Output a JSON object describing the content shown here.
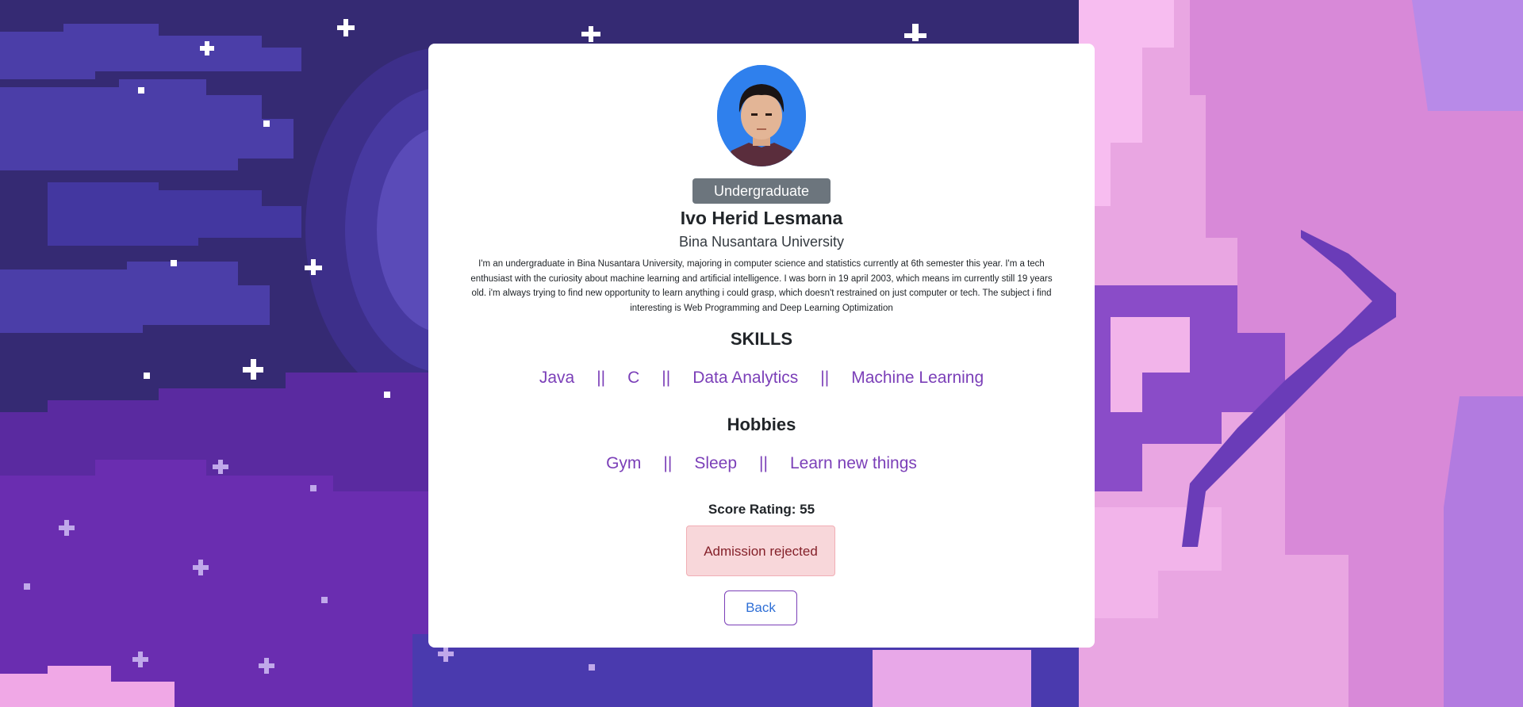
{
  "profile": {
    "status_badge": "Undergraduate",
    "name": "Ivo Herid Lesmana",
    "university": "Bina Nusantara University",
    "description": "I'm an undergraduate in Bina Nusantara University, majoring in computer science and statistics currently at 6th semester this year. I'm a tech enthusiast with the curiosity about machine learning and artificial intelligence. I was born in 19 april 2003, which means im currently still 19 years old. i'm always trying to find new opportunity to learn anything i could grasp, which doesn't restrained on just computer or tech. The subject i find interesting is Web Programming and Deep Learning Optimization"
  },
  "skills": {
    "title": "SKILLS",
    "separator": "||",
    "items": [
      "Java",
      "C",
      "Data Analytics",
      "Machine Learning"
    ]
  },
  "hobbies": {
    "title": "Hobbies",
    "separator": "||",
    "items": [
      "Gym",
      "Sleep",
      "Learn new things"
    ]
  },
  "score": {
    "label": "Score Rating:",
    "value": "55"
  },
  "admission": {
    "message": "Admission rejected"
  },
  "actions": {
    "back_label": "Back"
  },
  "colors": {
    "accent_purple": "#7b3fb8",
    "badge_gray": "#6c757d",
    "alert_bg": "#f8d7da",
    "alert_text": "#842029",
    "link_blue": "#2f6fd6"
  }
}
